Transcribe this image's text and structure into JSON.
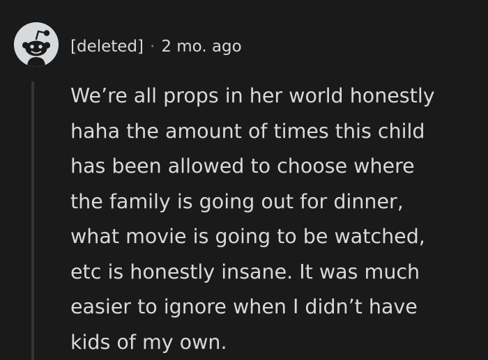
{
  "comment": {
    "author": "[deleted]",
    "separator": "·",
    "timestamp": "2 mo. ago",
    "avatar_icon": "reddit-snoo-icon",
    "body_lines": [
      "We’re all props in her world honestly",
      "haha the amount of times this child",
      "has been allowed to choose where",
      "the family is going out for dinner,",
      "what movie is going to be watched,",
      "etc is honestly insane. It was much",
      "easier to ignore when I didn’t have",
      "kids of my own."
    ]
  },
  "colors": {
    "background": "#1a1a1b",
    "text": "#d7dadc",
    "muted": "#818384",
    "thread_line": "#343536",
    "avatar_bg": "#d7dadc"
  }
}
